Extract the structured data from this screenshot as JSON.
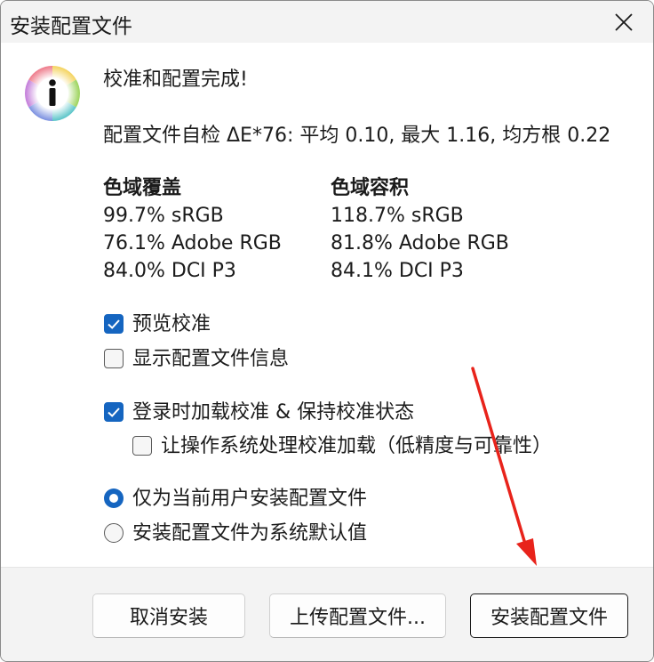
{
  "titlebar": {
    "title": "安装配置文件"
  },
  "content": {
    "heading": "校准和配置完成!",
    "self_check": "配置文件自检 ΔE*76: 平均 0.10, 最大 1.16, 均方根 0.22",
    "gamut_coverage": {
      "title": "色域覆盖",
      "items": [
        "99.7% sRGB",
        "76.1% Adobe RGB",
        "84.0% DCI P3"
      ]
    },
    "gamut_volume": {
      "title": "色域容积",
      "items": [
        "118.7% sRGB",
        "81.8% Adobe RGB",
        "84.1% DCI P3"
      ]
    },
    "options": {
      "preview_calibration": "预览校准",
      "show_profile_info": "显示配置文件信息",
      "load_on_login": "登录时加载校准 & 保持校准状态",
      "let_os_handle": "让操作系统处理校准加载（低精度与可靠性）",
      "install_current_user": "仅为当前用户安装配置文件",
      "install_system_default": "安装配置文件为系统默认值"
    }
  },
  "buttons": {
    "cancel": "取消安装",
    "upload": "上传配置文件...",
    "install": "安装配置文件"
  },
  "colors": {
    "accent": "#1565c0",
    "annotation_arrow": "#e8231b"
  }
}
